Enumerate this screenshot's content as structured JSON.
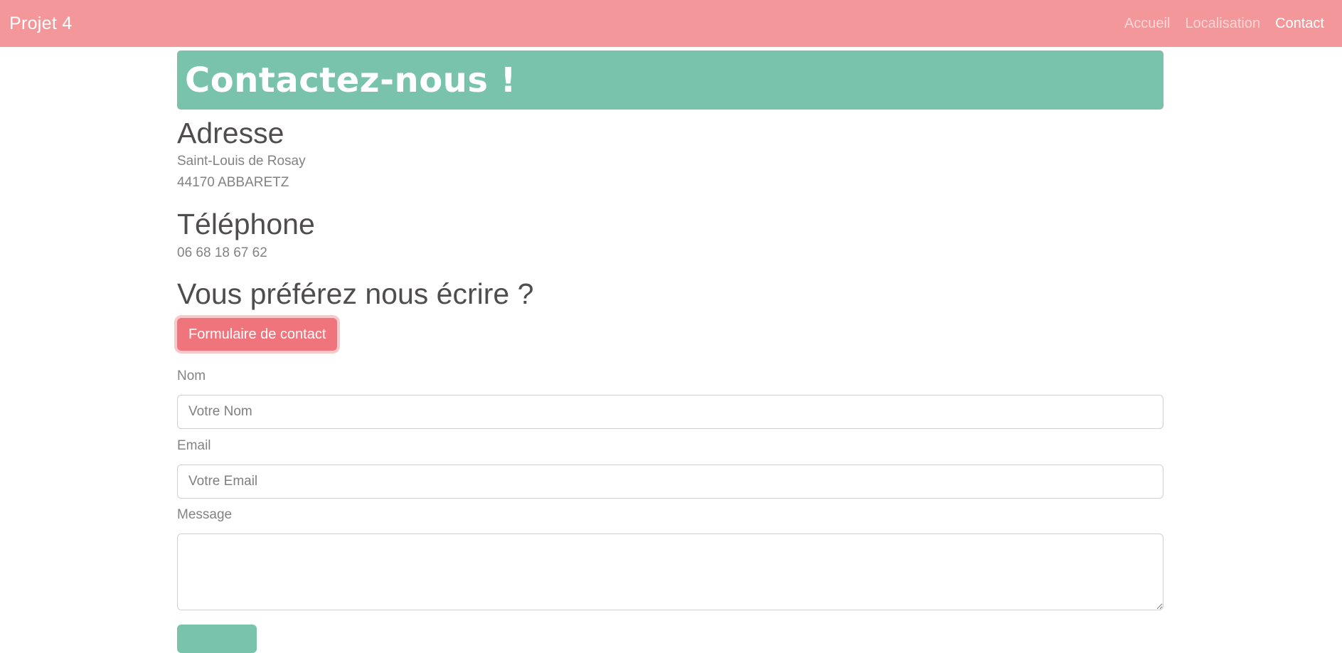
{
  "navbar": {
    "brand": "Projet 4",
    "links": [
      {
        "label": "Accueil",
        "active": false
      },
      {
        "label": "Localisation",
        "active": false
      },
      {
        "label": "Contact",
        "active": true
      }
    ]
  },
  "hero": {
    "title": "Contactez-nous !"
  },
  "address": {
    "title": "Adresse",
    "line1": "Saint-Louis de Rosay",
    "line2": "44170 ABBARETZ"
  },
  "phone": {
    "title": "Téléphone",
    "number": "06 68 18 67 62"
  },
  "write": {
    "title": "Vous préférez nous écrire ?",
    "button_label": "Formulaire de contact"
  },
  "form": {
    "name_label": "Nom",
    "name_placeholder": "Votre Nom",
    "email_label": "Email",
    "email_placeholder": "Votre Email",
    "message_label": "Message",
    "message_value": ""
  },
  "colors": {
    "navbar": "#f3979a",
    "hero": "#79c2ac",
    "button": "#f0747b",
    "submit": "#79c2ac"
  }
}
